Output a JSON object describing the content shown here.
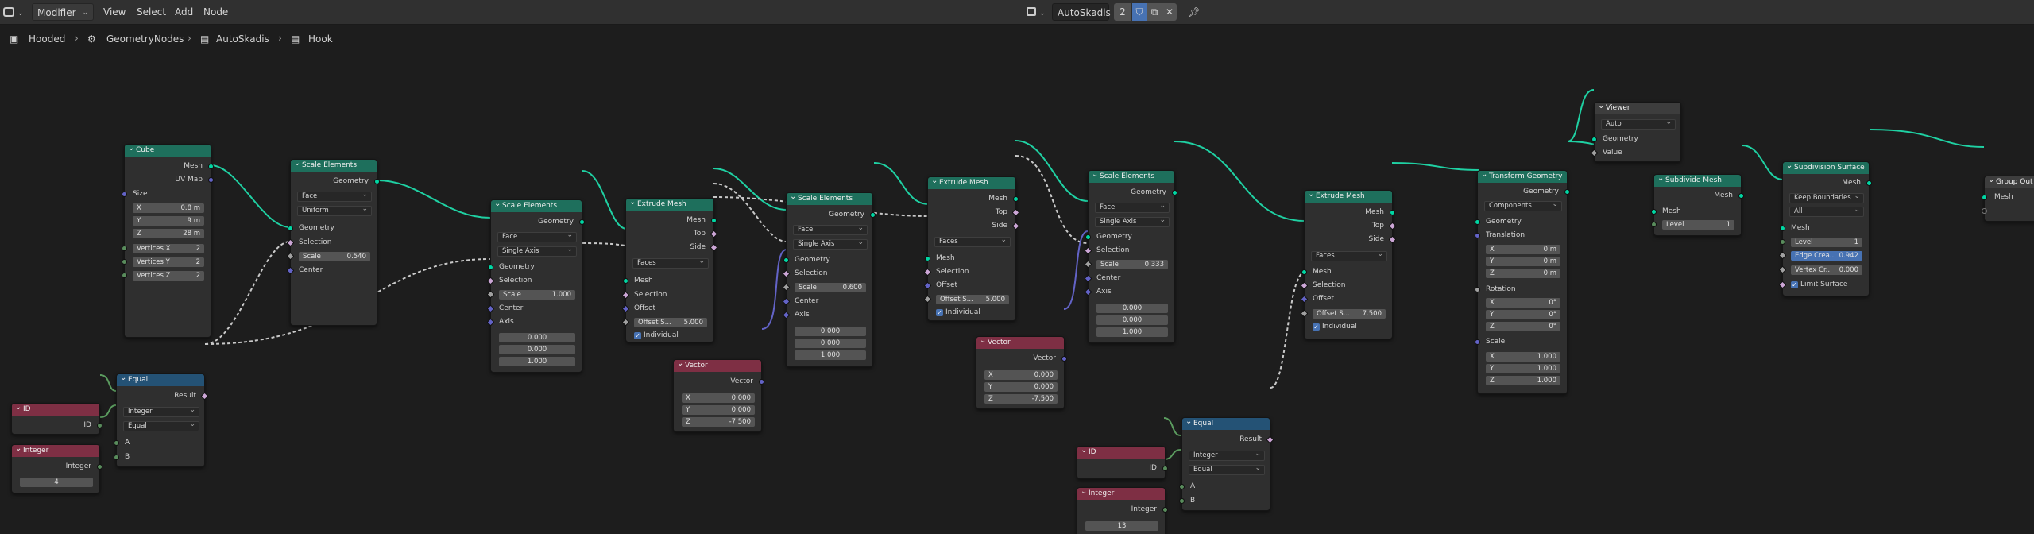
{
  "header": {
    "editor_icon": "node-editor-icon",
    "mode": "Modifier",
    "menus": [
      "View",
      "Select",
      "Add",
      "Node"
    ],
    "tree_name": "AutoSkadis",
    "user_count": "2",
    "pin_icon": "pin-icon"
  },
  "breadcrumb": [
    "Hooded",
    "GeometryNodes",
    "AutoSkadis",
    "Hook"
  ],
  "nodes": {
    "cube": {
      "title": "Cube",
      "out_mesh": "Mesh",
      "out_uv": "UV Map",
      "size_label": "Size",
      "x": {
        "l": "X",
        "v": "0.8 m"
      },
      "y": {
        "l": "Y",
        "v": "9 m"
      },
      "z": {
        "l": "Z",
        "v": "28 m"
      },
      "vx": {
        "l": "Vertices X",
        "v": "2"
      },
      "vy": {
        "l": "Vertices Y",
        "v": "2"
      },
      "vz": {
        "l": "Vertices Z",
        "v": "2"
      }
    },
    "scale1": {
      "title": "Scale Elements",
      "out": "Geometry",
      "domain": "Face",
      "mode": "Uniform",
      "in_geo": "Geometry",
      "in_sel": "Selection",
      "scale": {
        "l": "Scale",
        "v": "0.540"
      },
      "center": "Center"
    },
    "equal1": {
      "title": "Equal",
      "out": "Result",
      "type": "Integer",
      "op": "Equal",
      "a": "A",
      "b": "B"
    },
    "id1": {
      "title": "ID",
      "out": "ID"
    },
    "int1": {
      "title": "Integer",
      "out": "Integer",
      "value": "4"
    },
    "scale2": {
      "title": "Scale Elements",
      "out": "Geometry",
      "domain": "Face",
      "mode": "Single Axis",
      "in_geo": "Geometry",
      "in_sel": "Selection",
      "scale": {
        "l": "Scale",
        "v": "1.000"
      },
      "center": "Center",
      "axis": "Axis",
      "ax": "0.000",
      "ay": "0.000",
      "az": "1.000"
    },
    "extrude1": {
      "title": "Extrude Mesh",
      "out_mesh": "Mesh",
      "out_top": "Top",
      "out_side": "Side",
      "mode": "Faces",
      "in_mesh": "Mesh",
      "in_sel": "Selection",
      "offset": "Offset",
      "offset_scale": {
        "l": "Offset S...",
        "v": "5.000"
      },
      "individual": "Individual"
    },
    "vector1": {
      "title": "Vector",
      "out": "Vector",
      "x": {
        "l": "X",
        "v": "0.000"
      },
      "y": {
        "l": "Y",
        "v": "0.000"
      },
      "z": {
        "l": "Z",
        "v": "-7.500"
      }
    },
    "scale3": {
      "title": "Scale Elements",
      "out": "Geometry",
      "domain": "Face",
      "mode": "Single Axis",
      "in_geo": "Geometry",
      "in_sel": "Selection",
      "scale": {
        "l": "Scale",
        "v": "0.600"
      },
      "center": "Center",
      "axis": "Axis",
      "ax": "0.000",
      "ay": "0.000",
      "az": "1.000"
    },
    "extrude2": {
      "title": "Extrude Mesh",
      "out_mesh": "Mesh",
      "out_top": "Top",
      "out_side": "Side",
      "mode": "Faces",
      "in_mesh": "Mesh",
      "in_sel": "Selection",
      "offset": "Offset",
      "offset_scale": {
        "l": "Offset S...",
        "v": "5.000"
      },
      "individual": "Individual"
    },
    "vector2": {
      "title": "Vector",
      "out": "Vector",
      "x": {
        "l": "X",
        "v": "0.000"
      },
      "y": {
        "l": "Y",
        "v": "0.000"
      },
      "z": {
        "l": "Z",
        "v": "-7.500"
      }
    },
    "scale4": {
      "title": "Scale Elements",
      "out": "Geometry",
      "domain": "Face",
      "mode": "Single Axis",
      "in_geo": "Geometry",
      "in_sel": "Selection",
      "scale": {
        "l": "Scale",
        "v": "0.333"
      },
      "center": "Center",
      "axis": "Axis",
      "ax": "0.000",
      "ay": "0.000",
      "az": "1.000"
    },
    "extrude3": {
      "title": "Extrude Mesh",
      "out_mesh": "Mesh",
      "out_top": "Top",
      "out_side": "Side",
      "mode": "Faces",
      "in_mesh": "Mesh",
      "in_sel": "Selection",
      "offset": "Offset",
      "offset_scale": {
        "l": "Offset S...",
        "v": "7.500"
      },
      "individual": "Individual"
    },
    "equal2": {
      "title": "Equal",
      "out": "Result",
      "type": "Integer",
      "op": "Equal",
      "a": "A",
      "b": "B"
    },
    "id2": {
      "title": "ID",
      "out": "ID"
    },
    "int2": {
      "title": "Integer",
      "out": "Integer",
      "value": "13"
    },
    "transform": {
      "title": "Transform Geometry",
      "out": "Geometry",
      "mode": "Components",
      "in_geo": "Geometry",
      "translation": "Translation",
      "tx": {
        "l": "X",
        "v": "0 m"
      },
      "ty": {
        "l": "Y",
        "v": "0 m"
      },
      "tz": {
        "l": "Z",
        "v": "0 m"
      },
      "rotation": "Rotation",
      "rx": {
        "l": "X",
        "v": "0°"
      },
      "ry": {
        "l": "Y",
        "v": "0°"
      },
      "rz": {
        "l": "Z",
        "v": "0°"
      },
      "scale": "Scale",
      "sx": {
        "l": "X",
        "v": "1.000"
      },
      "sy": {
        "l": "Y",
        "v": "1.000"
      },
      "sz": {
        "l": "Z",
        "v": "1.000"
      }
    },
    "viewer": {
      "title": "Viewer",
      "domain": "Auto",
      "geo": "Geometry",
      "value": "Value"
    },
    "subdivide": {
      "title": "Subdivide Mesh",
      "out": "Mesh",
      "in": "Mesh",
      "level": {
        "l": "Level",
        "v": "1"
      }
    },
    "subsurf": {
      "title": "Subdivision Surface",
      "out": "Mesh",
      "boundary": "Keep Boundaries",
      "uv": "All",
      "in": "Mesh",
      "level": {
        "l": "Level",
        "v": "1"
      },
      "edge": {
        "l": "Edge Crea...",
        "v": "0.942"
      },
      "vertex": {
        "l": "Vertex Cr...",
        "v": "0.000"
      },
      "limit": "Limit Surface"
    },
    "groupout": {
      "title": "Group Out",
      "in": "Mesh"
    }
  }
}
